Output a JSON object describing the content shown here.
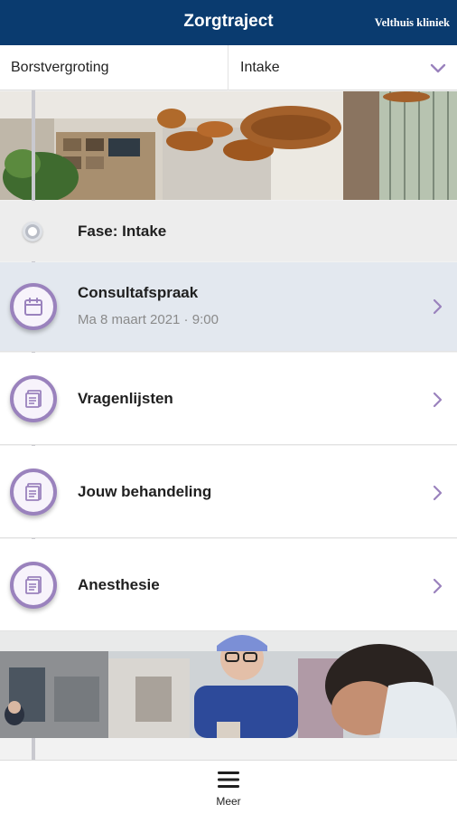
{
  "header": {
    "title": "Zorgtraject",
    "brand": "Velthuis kliniek"
  },
  "selectors": {
    "treatment": "Borstvergroting",
    "phase": "Intake"
  },
  "phase": {
    "label": "Fase: Intake"
  },
  "rows": [
    {
      "title": "Consultafspraak",
      "subtitle": "Ma 8 maart 2021 · 9:00",
      "icon": "calendar-icon"
    },
    {
      "title": "Vragenlijsten",
      "icon": "document-icon"
    },
    {
      "title": "Jouw behandeling",
      "icon": "document-icon"
    },
    {
      "title": "Anesthesie",
      "icon": "document-icon"
    }
  ],
  "bottom_nav": {
    "label": "Meer",
    "icon": "menu-icon"
  },
  "colors": {
    "header": "#0a3b6f",
    "accent": "#9a82bd",
    "active_row": "#e3e8ef"
  }
}
